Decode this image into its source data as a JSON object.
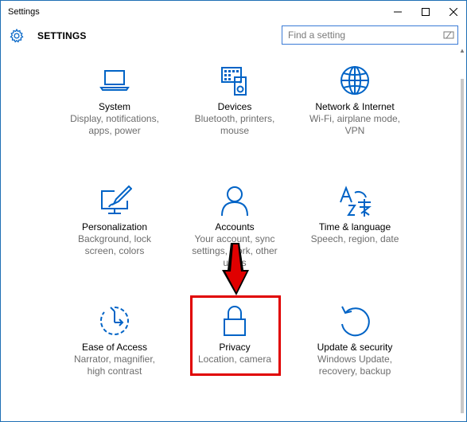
{
  "window": {
    "title": "Settings",
    "controls": {
      "minimize": "minimize",
      "maximize": "maximize",
      "close": "close"
    }
  },
  "header": {
    "title": "SETTINGS",
    "search": {
      "placeholder": "Find a setting",
      "value": ""
    }
  },
  "tiles": [
    {
      "id": "system",
      "name": "System",
      "desc": [
        "Display, notifications,",
        "apps, power"
      ],
      "icon": "laptop-icon"
    },
    {
      "id": "devices",
      "name": "Devices",
      "desc": [
        "Bluetooth, printers,",
        "mouse"
      ],
      "icon": "keyboard-speaker-icon"
    },
    {
      "id": "network",
      "name": "Network & Internet",
      "desc": [
        "Wi-Fi, airplane mode,",
        "VPN"
      ],
      "icon": "globe-icon"
    },
    {
      "id": "personalization",
      "name": "Personalization",
      "desc": [
        "Background, lock",
        "screen, colors"
      ],
      "icon": "paintbrush-monitor-icon"
    },
    {
      "id": "accounts",
      "name": "Accounts",
      "desc": [
        "Your account, sync",
        "settings, work, other",
        "users"
      ],
      "icon": "person-icon"
    },
    {
      "id": "time",
      "name": "Time & language",
      "desc": [
        "Speech, region, date"
      ],
      "icon": "language-icon"
    },
    {
      "id": "ease",
      "name": "Ease of Access",
      "desc": [
        "Narrator, magnifier,",
        "high contrast"
      ],
      "icon": "ease-of-access-icon"
    },
    {
      "id": "privacy",
      "name": "Privacy",
      "desc": [
        "Location, camera"
      ],
      "icon": "lock-icon"
    },
    {
      "id": "update",
      "name": "Update & security",
      "desc": [
        "Windows Update,",
        "recovery, backup"
      ],
      "icon": "refresh-icon"
    }
  ],
  "colors": {
    "accent": "#0063c6",
    "annotation": "#e00000",
    "desc_text": "#6d6d6d"
  }
}
